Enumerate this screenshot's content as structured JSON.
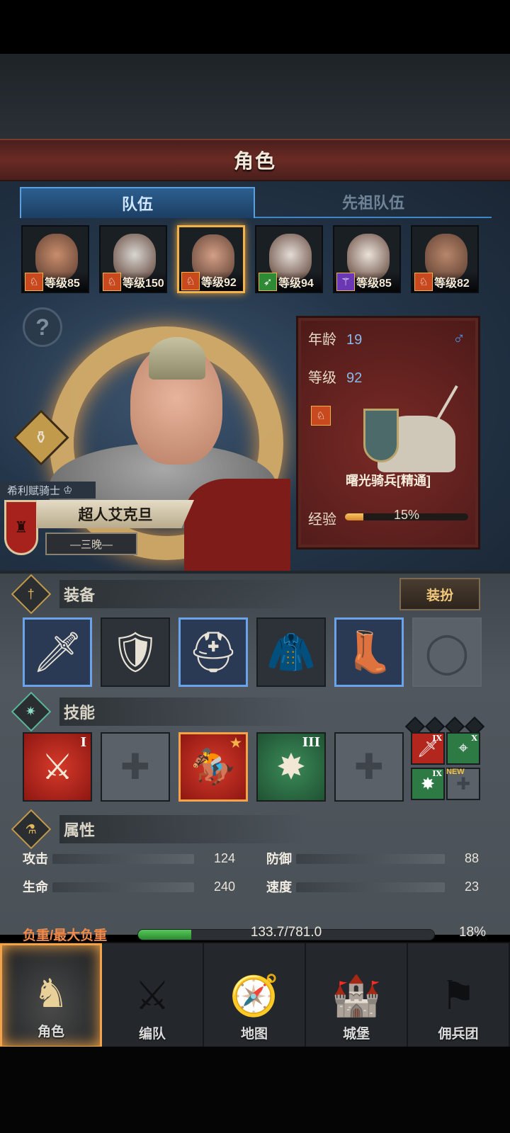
{
  "header": {
    "title": "角色"
  },
  "tabs": [
    {
      "label": "队伍",
      "active": true
    },
    {
      "label": "先祖队伍",
      "active": false
    }
  ],
  "roster": [
    {
      "level_text": "等级85",
      "class_icon": "horse-icon",
      "class_color": "#c7491d",
      "skin": "#c98d6c",
      "selected": false
    },
    {
      "level_text": "等级150",
      "class_icon": "horse-icon",
      "class_color": "#c7491d",
      "skin": "#d9d6d2",
      "selected": false
    },
    {
      "level_text": "等级92",
      "class_icon": "horse-icon",
      "class_color": "#c7491d",
      "skin": "#d39f86",
      "selected": true
    },
    {
      "level_text": "等级94",
      "class_icon": "bow-icon",
      "class_color": "#2f8a36",
      "skin": "#e4dcd6",
      "selected": false
    },
    {
      "level_text": "等级85",
      "class_icon": "staff-icon",
      "class_color": "#6a38b4",
      "skin": "#ebe2da",
      "selected": false
    },
    {
      "level_text": "等级82",
      "class_icon": "horse-icon",
      "class_color": "#c7491d",
      "skin": "#b8866a",
      "selected": false
    }
  ],
  "hero": {
    "faction": "希利赋骑士",
    "name": "超人艾克旦",
    "subtitle": "—三晚—"
  },
  "info": {
    "age_label": "年龄",
    "age": "19",
    "gender_symbol": "♂",
    "level_label": "等级",
    "level": "92",
    "unit_name": "曙光骑兵[精通]",
    "exp_label": "经验",
    "exp_pct": "15%",
    "exp_fraction": 0.15
  },
  "equipment": {
    "title": "装备",
    "dress_button": "装扮",
    "slots": [
      {
        "name": "sword-slot",
        "glyph": "🗡",
        "rarity": "blue"
      },
      {
        "name": "shield-slot",
        "glyph": "🛡",
        "rarity": "none"
      },
      {
        "name": "helmet-slot",
        "glyph": "⛑",
        "rarity": "blue"
      },
      {
        "name": "armor-slot",
        "glyph": "🧥",
        "rarity": "none"
      },
      {
        "name": "boots-slot",
        "glyph": "👢",
        "rarity": "blue"
      },
      {
        "name": "ring-slot",
        "glyph": "◯",
        "rarity": "empty"
      }
    ]
  },
  "skills": {
    "title": "技能",
    "items": [
      {
        "name": "skill-slash",
        "glyph": "⚔",
        "style": "red",
        "roman": "I"
      },
      {
        "name": "skill-empty-1",
        "glyph": "✚",
        "style": "empty",
        "roman": ""
      },
      {
        "name": "skill-charge",
        "glyph": "🏇",
        "style": "red",
        "roman": "★"
      },
      {
        "name": "skill-burst",
        "glyph": "✸",
        "style": "green",
        "roman": "III"
      },
      {
        "name": "skill-empty-2",
        "glyph": "✚",
        "style": "empty",
        "roman": ""
      }
    ],
    "mini": [
      {
        "name": "mini-sword",
        "glyph": "🗡",
        "color": "#b3261d",
        "roman": "IX"
      },
      {
        "name": "mini-target",
        "glyph": "⌖",
        "color": "#2e7a44",
        "roman": "X"
      },
      {
        "name": "mini-burst",
        "glyph": "✸",
        "color": "#2e7a44",
        "roman": "IX"
      },
      {
        "name": "mini-empty",
        "glyph": "✚",
        "color": "#5a6168",
        "roman": ""
      }
    ],
    "new_label": "NEW"
  },
  "attributes": {
    "title": "属性",
    "stats": [
      {
        "label": "攻击",
        "value": "124"
      },
      {
        "label": "防御",
        "value": "88"
      },
      {
        "label": "生命",
        "value": "240"
      },
      {
        "label": "速度",
        "value": "23"
      }
    ],
    "load_label": "负重/最大负重",
    "load_value": "133.7/781.0",
    "load_pct": "18%",
    "load_fraction": 0.18
  },
  "nav": [
    {
      "label": "角色",
      "icon": "knight-icon",
      "glyph": "♞",
      "active": true
    },
    {
      "label": "编队",
      "icon": "formation-icon",
      "glyph": "⚔",
      "active": false
    },
    {
      "label": "地图",
      "icon": "compass-icon",
      "glyph": "🧭",
      "active": false
    },
    {
      "label": "城堡",
      "icon": "castle-icon",
      "glyph": "🏰",
      "active": false
    },
    {
      "label": "佣兵团",
      "icon": "banner-icon",
      "glyph": "⚑",
      "active": false
    }
  ]
}
